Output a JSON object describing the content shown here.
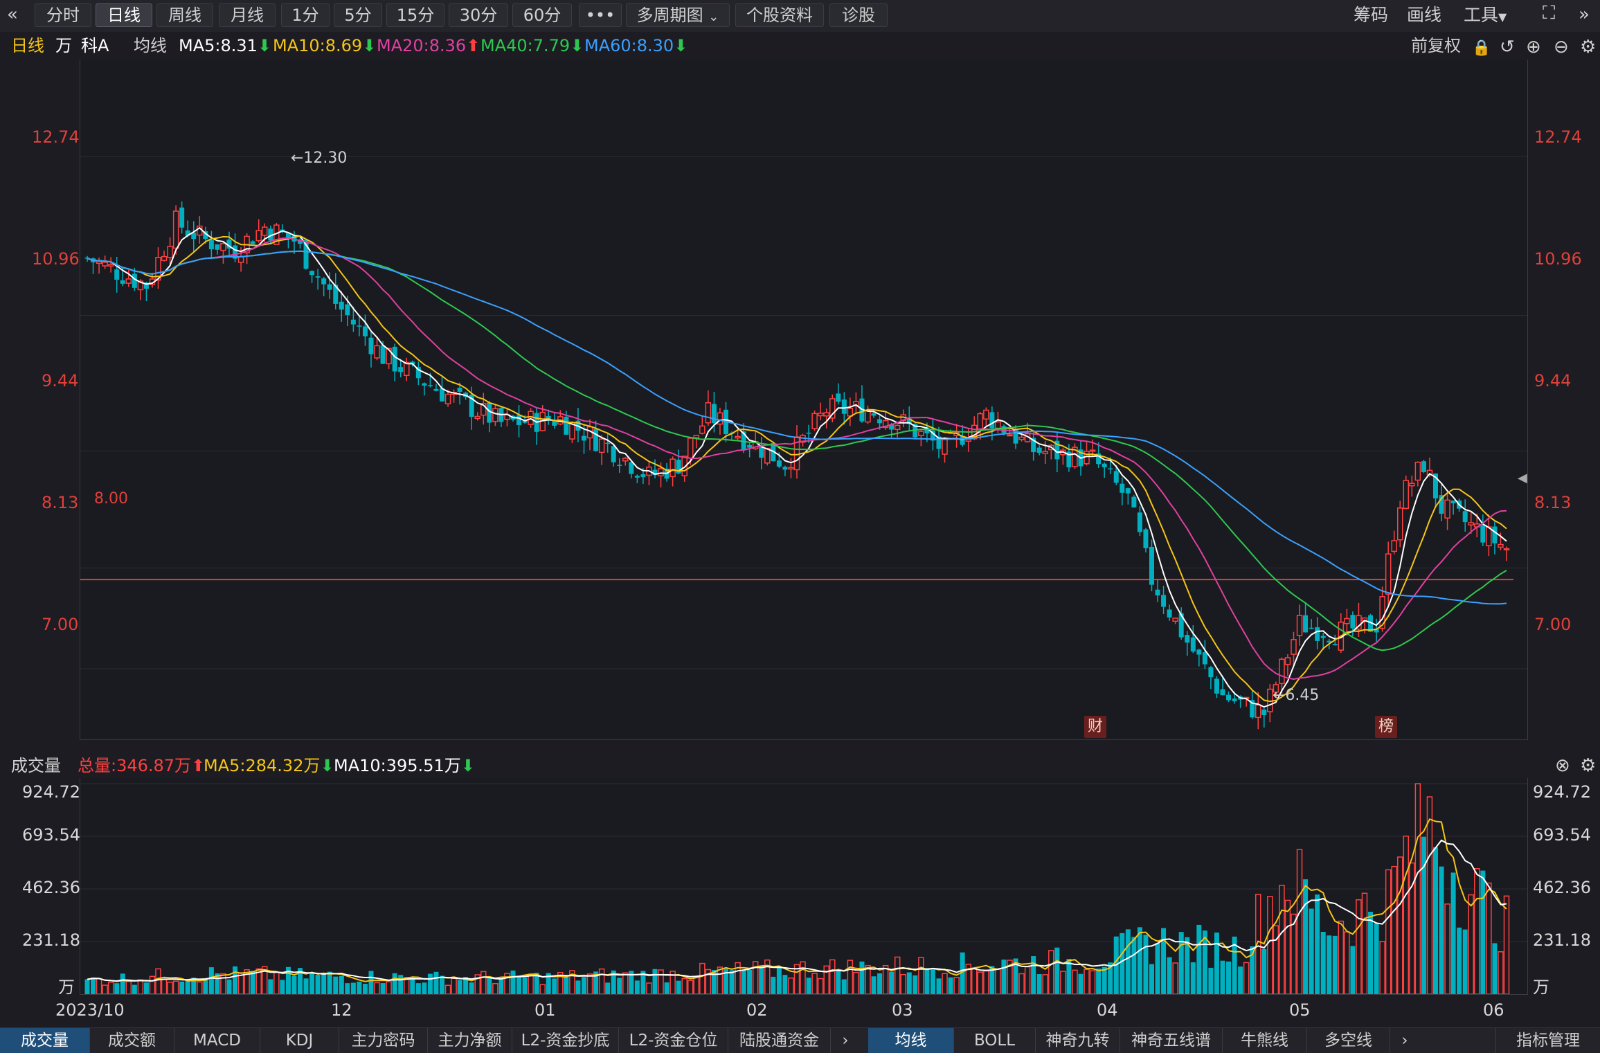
{
  "toolbar": {
    "back_icon": "double-chevron-left-icon",
    "tabs": [
      "分时",
      "日线",
      "周线",
      "月线",
      "1分",
      "5分",
      "15分",
      "30分",
      "60分"
    ],
    "active_tab": "日线",
    "more": "•••",
    "multi_period": "多周期图",
    "stock_info": "个股资料",
    "diagnose": "诊股",
    "right_items": [
      "筹码",
      "画线",
      "工具"
    ]
  },
  "ma_bar": {
    "period": "日线",
    "unit": "万",
    "name": "科A",
    "label": "均线",
    "ma5": "MA5:8.31",
    "ma10": "MA10:8.69",
    "ma20": "MA20:8.36",
    "ma40": "MA40:7.79",
    "ma60": "MA60:8.30",
    "fuquan": "前复权",
    "colors": {
      "ma5": "#ffffff",
      "ma10": "#f5c518",
      "ma20": "#e040a0",
      "ma40": "#2ec850",
      "ma60": "#3aa0ff",
      "up": "#ff4040",
      "down": "#00b0c0"
    }
  },
  "main_axis": {
    "ticks": [
      "12.74",
      "10.96",
      "9.44",
      "8.13",
      "7.00"
    ],
    "line_label": "8.00",
    "high_label": "←12.30",
    "low_label": "←6.45",
    "marker_cai": "财",
    "marker_bang": "榜"
  },
  "volume_bar": {
    "title": "成交量",
    "total": "总量:346.87万",
    "ma5": "MA5:284.32万",
    "ma10": "MA10:395.51万"
  },
  "volume_axis": {
    "ticks": [
      "924.72",
      "693.54",
      "462.36",
      "231.18"
    ],
    "unit": "万"
  },
  "x_axis": [
    "2023/10",
    "12",
    "01",
    "02",
    "03",
    "04",
    "05",
    "06"
  ],
  "bottom_tabs_left": [
    "成交量",
    "成交额",
    "MACD",
    "KDJ",
    "主力密码",
    "主力净额",
    "L2-资金抄底",
    "L2-资金仓位",
    "陆股通资金"
  ],
  "bottom_tabs_right": [
    "均线",
    "BOLL",
    "神奇九转",
    "神奇五线谱",
    "牛熊线",
    "多空线"
  ],
  "indicator_manage": "指标管理",
  "chart_data": {
    "type": "candlestick",
    "price_range": [
      6.2,
      13.3
    ],
    "volume_range": [
      0,
      924.72
    ],
    "ma_series_names": [
      "MA5",
      "MA10",
      "MA20",
      "MA40",
      "MA60"
    ],
    "price_anchors": [
      [
        0,
        11.6
      ],
      [
        10,
        11.3
      ],
      [
        15,
        12.0
      ],
      [
        20,
        11.8
      ],
      [
        25,
        11.7
      ],
      [
        30,
        11.95
      ],
      [
        35,
        11.8
      ],
      [
        42,
        11.1
      ],
      [
        50,
        10.5
      ],
      [
        60,
        10.1
      ],
      [
        70,
        9.75
      ],
      [
        80,
        9.8
      ],
      [
        88,
        9.5
      ],
      [
        95,
        9.15
      ],
      [
        100,
        9.3
      ],
      [
        105,
        9.85
      ],
      [
        112,
        9.55
      ],
      [
        118,
        9.3
      ],
      [
        125,
        9.9
      ],
      [
        132,
        9.9
      ],
      [
        138,
        9.75
      ],
      [
        145,
        9.45
      ],
      [
        152,
        9.85
      ],
      [
        160,
        9.45
      ],
      [
        170,
        9.35
      ],
      [
        176,
        8.9
      ],
      [
        180,
        8.0
      ],
      [
        186,
        7.3
      ],
      [
        192,
        6.7
      ],
      [
        199,
        6.5
      ],
      [
        205,
        7.5
      ],
      [
        211,
        7.4
      ],
      [
        218,
        7.5
      ],
      [
        222,
        8.9
      ],
      [
        226,
        9.3
      ],
      [
        229,
        8.8
      ],
      [
        234,
        8.6
      ],
      [
        240,
        8.35
      ]
    ],
    "volume_anchors": [
      [
        0,
        60
      ],
      [
        20,
        90
      ],
      [
        40,
        80
      ],
      [
        60,
        70
      ],
      [
        80,
        75
      ],
      [
        100,
        90
      ],
      [
        120,
        110
      ],
      [
        140,
        120
      ],
      [
        160,
        140
      ],
      [
        170,
        150
      ],
      [
        180,
        230
      ],
      [
        195,
        200
      ],
      [
        203,
        520
      ],
      [
        210,
        300
      ],
      [
        220,
        420
      ],
      [
        226,
        780
      ],
      [
        232,
        520
      ],
      [
        240,
        300
      ]
    ]
  }
}
